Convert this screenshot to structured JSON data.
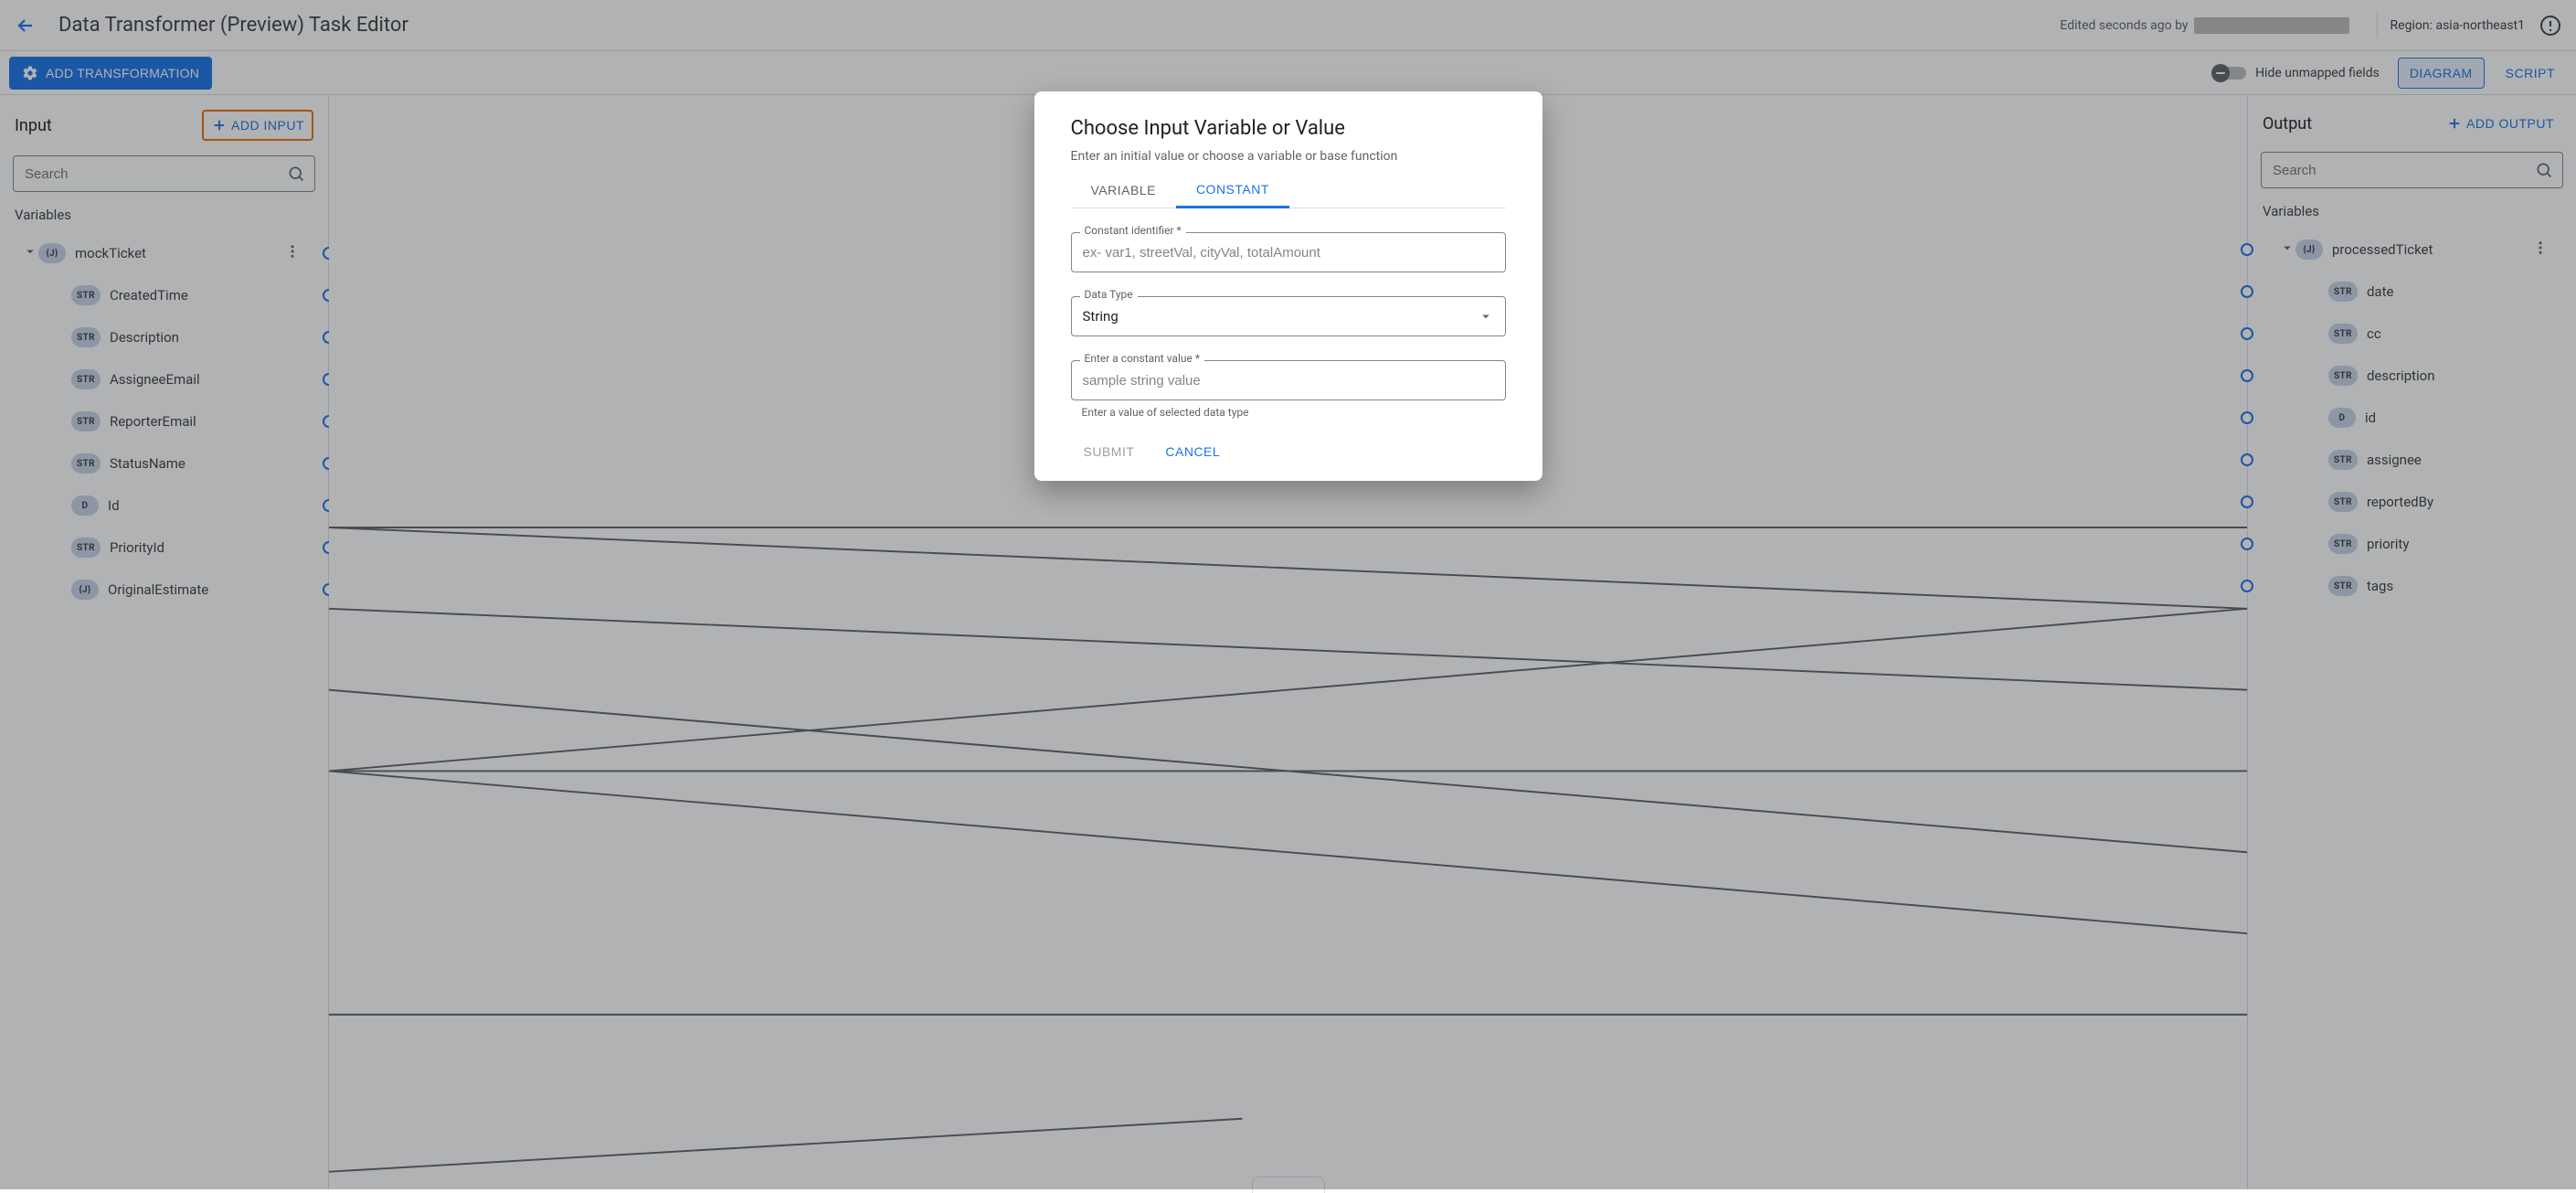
{
  "topbar": {
    "title": "Data Transformer (Preview) Task Editor",
    "edited_prefix": "Edited seconds ago by",
    "region_prefix": "Region:",
    "region_value": "asia-northeast1"
  },
  "actionbar": {
    "add_transformation": "ADD TRANSFORMATION",
    "hide_unmapped": "Hide unmapped fields",
    "diagram": "DIAGRAM",
    "script": "SCRIPT"
  },
  "input_panel": {
    "heading": "Input",
    "add_label": "ADD INPUT",
    "search_placeholder": "Search",
    "variables_label": "Variables",
    "root": {
      "chip": "{J}",
      "label": "mockTicket"
    },
    "fields": [
      {
        "chip": "STR",
        "label": "CreatedTime"
      },
      {
        "chip": "STR",
        "label": "Description"
      },
      {
        "chip": "STR",
        "label": "AssigneeEmail"
      },
      {
        "chip": "STR",
        "label": "ReporterEmail"
      },
      {
        "chip": "STR",
        "label": "StatusName"
      },
      {
        "chip": "D",
        "label": "Id"
      },
      {
        "chip": "STR",
        "label": "PriorityId"
      },
      {
        "chip": "{J}",
        "label": "OriginalEstimate"
      }
    ]
  },
  "output_panel": {
    "heading": "Output",
    "add_label": "ADD OUTPUT",
    "search_placeholder": "Search",
    "variables_label": "Variables",
    "root": {
      "chip": "{J}",
      "label": "processedTicket"
    },
    "fields": [
      {
        "chip": "STR",
        "label": "date"
      },
      {
        "chip": "STR",
        "label": "cc"
      },
      {
        "chip": "STR",
        "label": "description"
      },
      {
        "chip": "D",
        "label": "id"
      },
      {
        "chip": "STR",
        "label": "assignee"
      },
      {
        "chip": "STR",
        "label": "reportedBy"
      },
      {
        "chip": "STR",
        "label": "priority"
      },
      {
        "chip": "STR",
        "label": "tags"
      }
    ]
  },
  "modal": {
    "title": "Choose Input Variable or Value",
    "subtitle": "Enter an initial value or choose a variable or base function",
    "tab_variable": "VARIABLE",
    "tab_constant": "CONSTANT",
    "id_label": "Constant identifier *",
    "id_placeholder": "ex- var1, streetVal, cityVal, totalAmount",
    "type_label": "Data Type",
    "type_value": "String",
    "value_label": "Enter a constant value *",
    "value_placeholder": "sample string value",
    "value_helper": "Enter a value of selected data type",
    "submit": "SUBMIT",
    "cancel": "CANCEL"
  }
}
